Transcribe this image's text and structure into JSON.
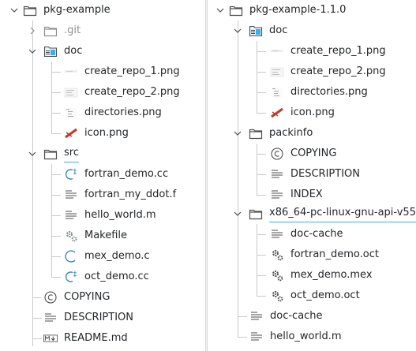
{
  "left": {
    "root": "pkg-example",
    "git": ".git",
    "doc": "doc",
    "doc_files": [
      "create_repo_1.png",
      "create_repo_2.png",
      "directories.png",
      "icon.png"
    ],
    "src": "src",
    "src_files": [
      "fortran_demo.cc",
      "fortran_my_ddot.f",
      "hello_world.m",
      "Makefile",
      "mex_demo.c",
      "oct_demo.cc"
    ],
    "copying": "COPYING",
    "description": "DESCRIPTION",
    "readme": "README.md"
  },
  "right": {
    "root": "pkg-example-1.1.0",
    "doc": "doc",
    "doc_files": [
      "create_repo_1.png",
      "create_repo_2.png",
      "directories.png",
      "icon.png"
    ],
    "packinfo": "packinfo",
    "packinfo_files": [
      "COPYING",
      "DESCRIPTION",
      "INDEX"
    ],
    "arch": "x86_64-pc-linux-gnu-api-v55",
    "arch_files": [
      "doc-cache",
      "fortran_demo.oct",
      "mex_demo.mex",
      "oct_demo.oct"
    ],
    "doc_cache": "doc-cache",
    "hello": "hello_world.m"
  },
  "colors": {
    "accent": "#3daee9",
    "icon": "#4d4d4d",
    "dim": "#8d9194",
    "guide": "#c7c9cb"
  }
}
